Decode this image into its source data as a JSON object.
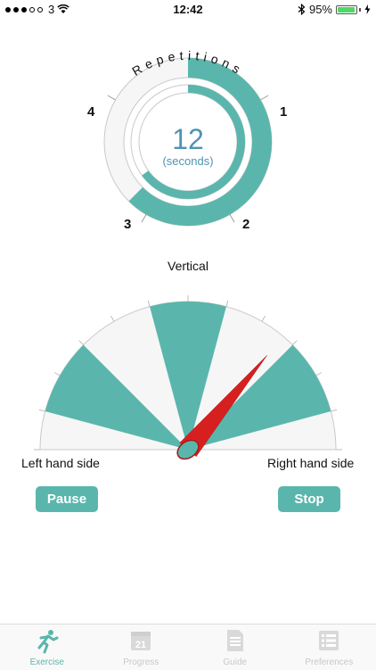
{
  "status_bar": {
    "carrier": "3",
    "time": "12:42",
    "battery": "95%",
    "signal_bars_filled": 3,
    "signal_bars_total": 5
  },
  "repetitions": {
    "title": "Repetitions",
    "markers": [
      "1",
      "2",
      "3",
      "4"
    ],
    "outer_progress": 0.625,
    "inner_progress": 0.65,
    "center_value": "12",
    "center_unit": "(seconds)"
  },
  "gauge": {
    "top_label": "Vertical",
    "left_label": "Left hand side",
    "right_label": "Right hand side",
    "needle_angle_deg": 40
  },
  "controls": {
    "pause_label": "Pause",
    "stop_label": "Stop"
  },
  "tabs": [
    {
      "label": "Exercise",
      "icon": "runner-icon",
      "active": true
    },
    {
      "label": "Progress",
      "icon": "calendar-icon",
      "active": false
    },
    {
      "label": "Guide",
      "icon": "document-icon",
      "active": false
    },
    {
      "label": "Preferences",
      "icon": "list-icon",
      "active": false
    }
  ],
  "colors": {
    "accent": "#5ab6ac",
    "needle": "#d62020",
    "center_text": "#4f93b3"
  }
}
